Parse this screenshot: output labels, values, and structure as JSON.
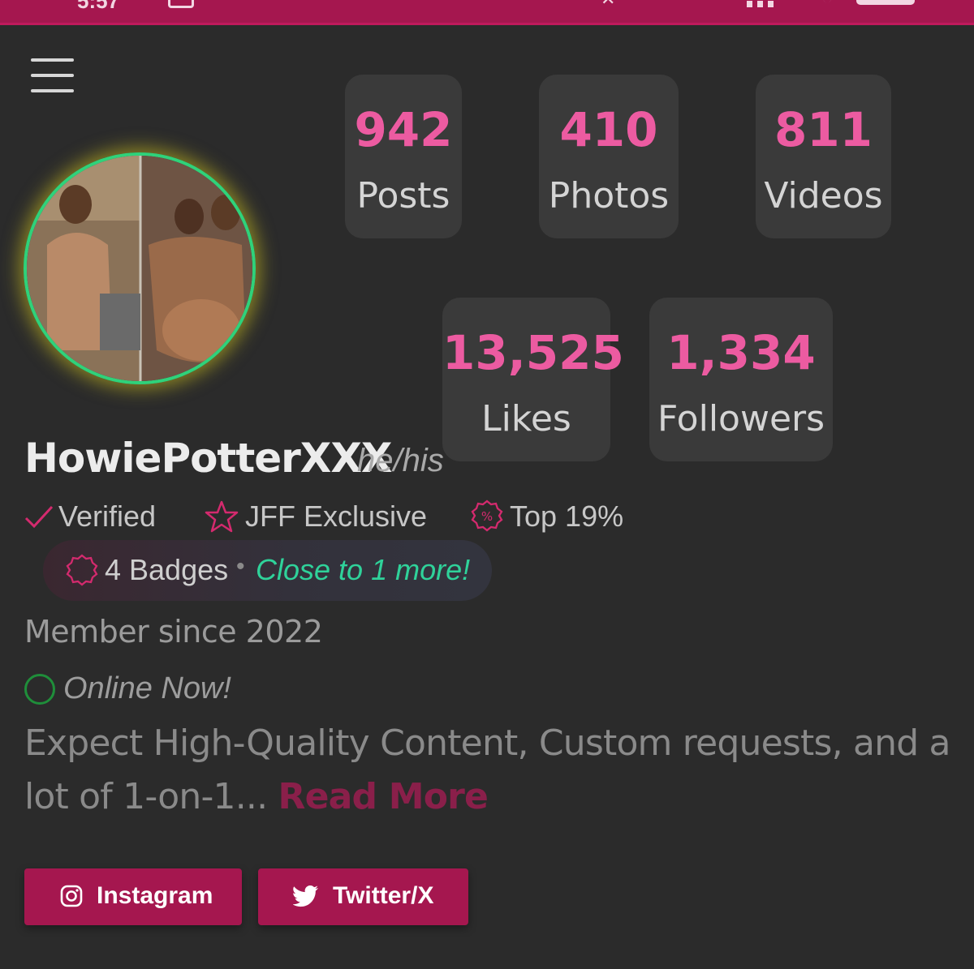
{
  "status_bar": {
    "time": "5:57"
  },
  "profile": {
    "username": "HowiePotterXXX",
    "pronouns": "he/his",
    "member_since": "Member since 2022",
    "online_status": "Online Now!"
  },
  "stats": [
    {
      "value": "942",
      "label": "Posts"
    },
    {
      "value": "410",
      "label": "Photos"
    },
    {
      "value": "811",
      "label": "Videos"
    },
    {
      "value": "13,525",
      "label": "Likes"
    },
    {
      "value": "1,334",
      "label": "Followers"
    }
  ],
  "badges_row": {
    "verified": "Verified",
    "exclusive": "JFF Exclusive",
    "top": "Top 19%"
  },
  "badges_pill": {
    "count": "4 Badges",
    "separator": "•",
    "more": "Close to 1 more!"
  },
  "bio": {
    "text": "Expect High-Quality Content, Custom requests, and a lot of 1-on-1...",
    "read_more": "Read More"
  },
  "social": {
    "instagram": "Instagram",
    "twitter": "Twitter/X"
  },
  "colors": {
    "accent": "#a5174f",
    "stat_value": "#ec5ba1",
    "online": "#1f8e3a",
    "close_more": "#2fd29a",
    "avatar_ring": "#2fd27a"
  }
}
